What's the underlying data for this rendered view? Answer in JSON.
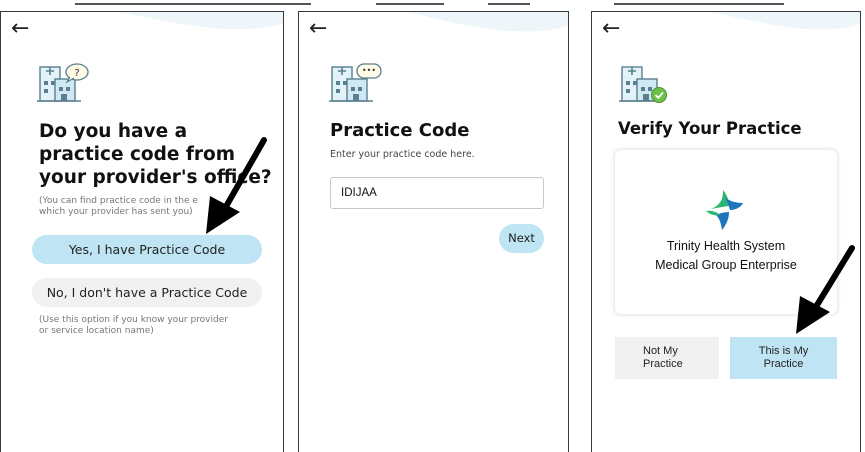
{
  "panel1": {
    "back_glyph": "←",
    "heading_lines": [
      "Do you have a",
      "practice code from",
      "your provider's office?"
    ],
    "hint_lines": [
      "(You can find practice code in the e",
      "which your provider has sent you)"
    ],
    "yes_button": "Yes, I have Practice Code",
    "no_button": "No, I don't have a Practice Code",
    "note_lines": [
      "(Use this option if you know your provider",
      "or service location name)"
    ],
    "icon_badge": "?"
  },
  "panel2": {
    "back_glyph": "←",
    "title": "Practice Code",
    "subtitle": "Enter your practice code here.",
    "code_value": "IDIJAA",
    "next_button": "Next",
    "icon_badge": "•••"
  },
  "panel3": {
    "back_glyph": "←",
    "title": "Verify Your Practice",
    "practice_name_lines": [
      "Trinity Health System",
      "Medical Group Enterprise"
    ],
    "not_my_practice_lines": [
      "Not My",
      "Practice"
    ],
    "this_is_my_practice_lines": [
      "This is My",
      "Practice"
    ]
  },
  "colors": {
    "accent_light": "#bfe4f3",
    "gray_button": "#f1f1f1",
    "logo_green": "#2bb673",
    "logo_blue": "#1d75bc",
    "check_green": "#6cc04a"
  },
  "icons": [
    "back-arrow-icon",
    "hospital-question-icon",
    "hospital-chat-icon",
    "hospital-check-icon",
    "trinity-health-logo",
    "annotation-arrow"
  ]
}
